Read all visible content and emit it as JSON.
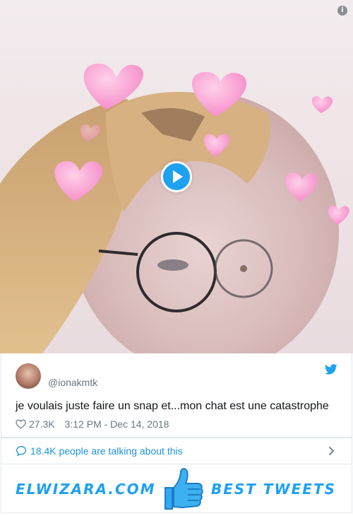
{
  "media": {
    "info_icon": "info-icon",
    "play_icon": "play-icon"
  },
  "tweet": {
    "handle": "@ionakmtk",
    "text": "je voulais juste faire un snap et...mon chat est une catastrophe",
    "likes": "27.3K",
    "timestamp": "3:12 PM - Dec 14, 2018",
    "brand_icon": "twitter-icon"
  },
  "conversation": {
    "text": "18.4K people are talking about this"
  },
  "banner": {
    "left_text": "ELWIZARA.COM",
    "right_text": "BEST TWEETS",
    "icon": "thumbs-up-icon"
  },
  "colors": {
    "accent": "#1da1f2",
    "link": "#1b95e0",
    "muted": "#657786",
    "text": "#14171a"
  }
}
